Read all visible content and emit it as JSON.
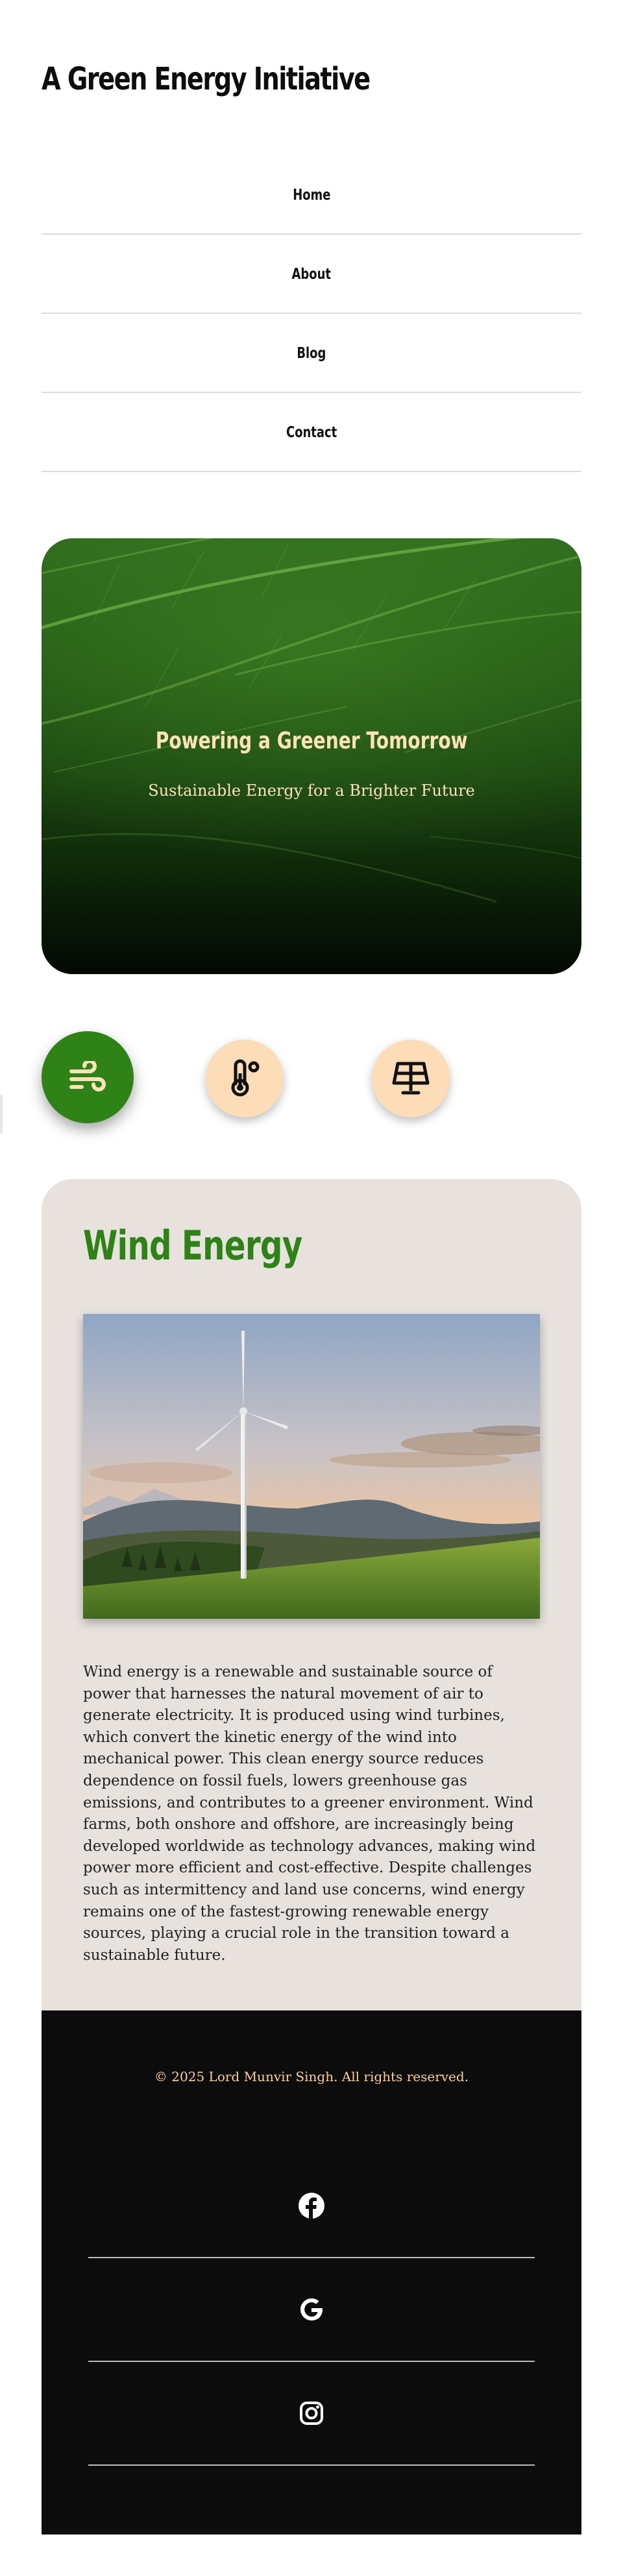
{
  "site": {
    "title": "A Green Energy Initiative"
  },
  "nav": {
    "items": [
      {
        "label": "Home"
      },
      {
        "label": "About"
      },
      {
        "label": "Blog"
      },
      {
        "label": "Contact"
      }
    ]
  },
  "hero": {
    "title": "Powering a Greener Tomorrow",
    "subtitle": "Sustainable Energy for a Brighter Future"
  },
  "selectors": [
    {
      "icon": "wind-icon",
      "active": true
    },
    {
      "icon": "thermometer-icon",
      "active": false
    },
    {
      "icon": "solar-panel-icon",
      "active": false
    }
  ],
  "card": {
    "title": "Wind Energy",
    "image_alt": "wind-turbine-photo",
    "body": "Wind energy is a renewable and sustainable source of power that harnesses the natural movement of air to generate electricity. It is produced using wind turbines, which convert the kinetic energy of the wind into mechanical power. This clean energy source reduces dependence on fossil fuels, lowers greenhouse gas emissions, and contributes to a greener environment. Wind farms, both onshore and offshore, are increasingly being developed worldwide as technology advances, making wind power more efficient and cost-effective. Despite challenges such as intermittency and land use concerns, wind energy remains one of the fastest-growing renewable energy sources, playing a crucial role in the transition toward a sustainable future."
  },
  "footer": {
    "copyright": "© 2025 Lord Munvir Singh. All rights reserved.",
    "social": [
      {
        "icon": "facebook-icon"
      },
      {
        "icon": "google-icon"
      },
      {
        "icon": "instagram-icon"
      }
    ]
  },
  "colors": {
    "accent_green": "#2e8216",
    "peach": "#fddcb8",
    "hero_text": "#ffe1b8",
    "card_bg": "#e7e2de",
    "footer_bg": "#0d0c0c"
  }
}
